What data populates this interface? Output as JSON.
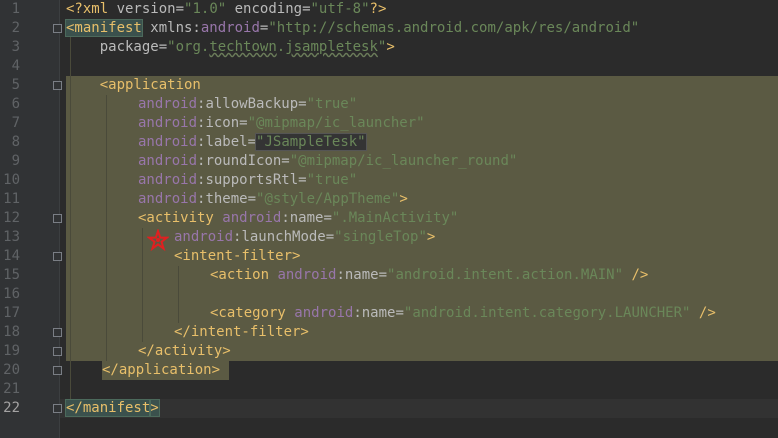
{
  "gutter": {
    "line_numbers": [
      "1",
      "2",
      "3",
      "4",
      "5",
      "6",
      "7",
      "8",
      "9",
      "10",
      "11",
      "12",
      "13",
      "14",
      "15",
      "16",
      "17",
      "18",
      "19",
      "20",
      "21",
      "22"
    ],
    "current_line": "22"
  },
  "code": {
    "l1": {
      "a": "<?xml ",
      "b": "version",
      "c": "=",
      "d": "\"1.0\"",
      "e": " ",
      "f": "encoding",
      "g": "=",
      "h": "\"utf-8\"",
      "i": "?>"
    },
    "l2": {
      "a": "<manifest",
      "b": " xmlns:",
      "c": "android",
      "d": "=",
      "e": "\"http://schemas.android.com/apk/res/android\""
    },
    "l3": {
      "a": "    package",
      "b": "=",
      "c": "\"org.",
      "d": "techtown",
      "e": ".",
      "f": "jsampletesk",
      "g": "\"",
      "h": ">"
    },
    "l5": {
      "a": "    <application"
    },
    "l6": {
      "a": "android",
      "b": ":allowBackup=",
      "c": "\"true\""
    },
    "l7": {
      "a": "android",
      "b": ":icon=",
      "c": "\"@mipmap/ic_launcher\""
    },
    "l8": {
      "a": "android",
      "b": ":label=",
      "c": "\"JSampleTesk\""
    },
    "l9": {
      "a": "android",
      "b": ":roundIcon=",
      "c": "\"@mipmap/ic_launcher_round\""
    },
    "l10": {
      "a": "android",
      "b": ":supportsRtl=",
      "c": "\"true\""
    },
    "l11": {
      "a": "android",
      "b": ":theme=",
      "c": "\"@style/AppTheme\"",
      "d": ">"
    },
    "l12": {
      "a": "<activity ",
      "b": "android",
      "c": ":name=",
      "d": "\".MainActivity\""
    },
    "l13": {
      "a": "android",
      "b": ":launchMode=",
      "c": "\"singleTop\"",
      "d": ">"
    },
    "l14": {
      "a": "<intent-filter>"
    },
    "l15": {
      "a": "<action ",
      "b": "android",
      "c": ":name=",
      "d": "\"android.intent.action.MAIN\"",
      "e": " />"
    },
    "l17": {
      "a": "<category ",
      "b": "android",
      "c": ":name=",
      "d": "\"android.intent.category.LAUNCHER\"",
      "e": " />"
    },
    "l18": {
      "a": "</intent-filter>"
    },
    "l19": {
      "a": "</activity>"
    },
    "l20": {
      "a": "</application>"
    },
    "l22": {
      "a": "</manifest",
      "b": ">"
    }
  },
  "colors": {
    "background": "#2b2b2b",
    "gutter": "#313335",
    "selection": "#5b5a43",
    "tag": "#e8bf6a",
    "namespace": "#9876aa",
    "string": "#6a8759",
    "attribute": "#bababa"
  },
  "icons": {
    "gutter_mark": "pentagram-mark-icon"
  }
}
